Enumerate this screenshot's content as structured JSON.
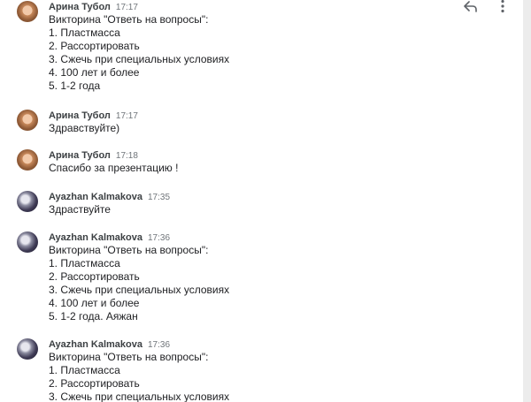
{
  "messages": [
    {
      "author": "Арина Тубол",
      "time": "17:17",
      "lines": [
        "Викторина \"Ответь на вопросы\":",
        "1. Пластмасса",
        "2. Рассортировать",
        "3. Сжечь при специальных условиях",
        "4. 100 лет и более",
        "5. 1-2 года"
      ]
    },
    {
      "author": "Арина Тубол",
      "time": "17:17",
      "lines": [
        "Здравствуйте)"
      ]
    },
    {
      "author": "Арина Тубол",
      "time": "17:18",
      "lines": [
        "Спасибо за презентацию !"
      ]
    },
    {
      "author": "Ayazhan Kalmakova",
      "time": "17:35",
      "lines": [
        "Здраствуйте"
      ]
    },
    {
      "author": "Ayazhan Kalmakova",
      "time": "17:36",
      "lines": [
        "Викторина \"Ответь на вопросы\":",
        "1. Пластмасса",
        "2. Рассортировать",
        "3. Сжечь при специальных условиях",
        "4. 100 лет и более",
        "5. 1-2 года.  Аяжан"
      ]
    },
    {
      "author": "Ayazhan Kalmakova",
      "time": "17:36",
      "lines": [
        "Викторина \"Ответь на вопросы\":",
        "1. Пластмасса",
        "2. Рассортировать",
        "3. Сжечь при специальных условиях"
      ]
    }
  ],
  "icons": {
    "reply": "reply-icon",
    "more": "more-vert-icon"
  }
}
